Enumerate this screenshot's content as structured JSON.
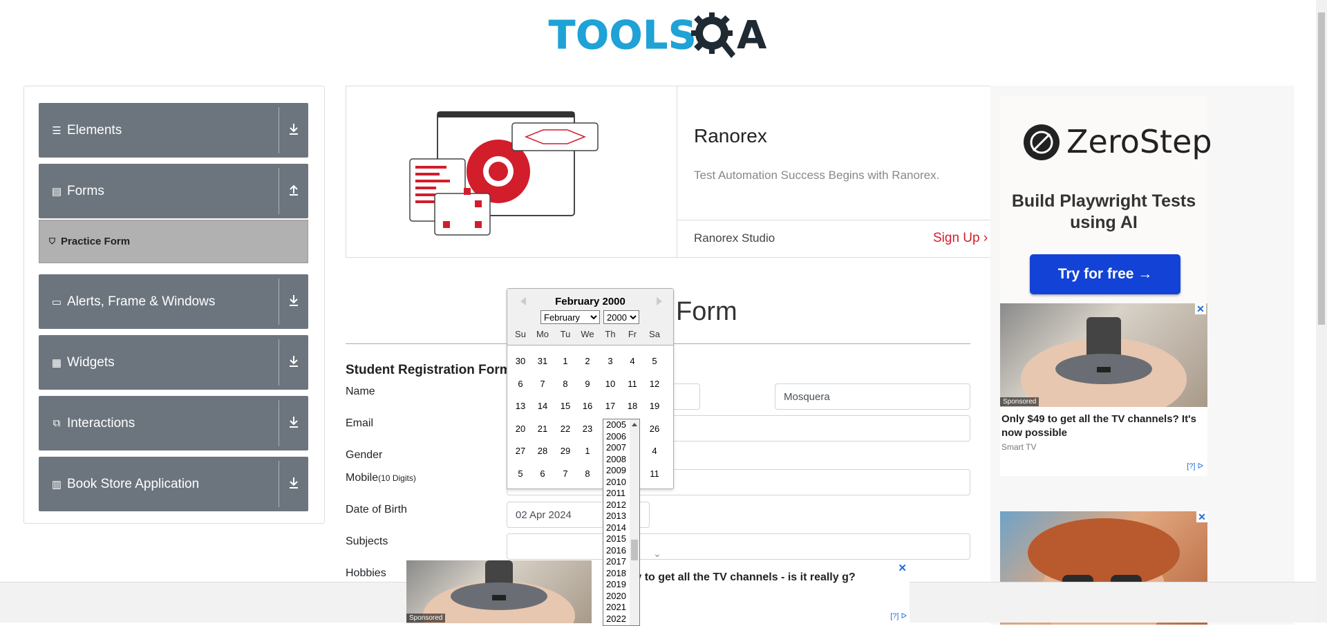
{
  "logo": {
    "text_main": "TOOLS",
    "text_tail": "A"
  },
  "sidebar": {
    "groups": [
      {
        "label": "Elements",
        "icon": "hamburger-icon"
      },
      {
        "label": "Forms",
        "icon": "document-icon"
      },
      {
        "label": "Alerts, Frame & Windows",
        "icon": "window-icon"
      },
      {
        "label": "Widgets",
        "icon": "widgets-icon"
      },
      {
        "label": "Interactions",
        "icon": "interactions-icon"
      },
      {
        "label": "Book Store Application",
        "icon": "books-icon"
      }
    ],
    "active_sub": {
      "label": "Practice Form",
      "icon": "html5-icon"
    }
  },
  "banner": {
    "title": "Ranorex",
    "description": "Test Automation Success Begins with Ranorex.",
    "product": "Ranorex Studio",
    "cta": "Sign Up"
  },
  "page": {
    "title_visible": "Form",
    "section": "Student Registration Form"
  },
  "form": {
    "name_label": "Name",
    "last_name_value": "Mosquera",
    "email_label": "Email",
    "gender_label": "Gender",
    "mobile_label": "Mobile",
    "mobile_hint": "(10 Digits)",
    "dob_label": "Date of Birth",
    "dob_value": "02 Apr 2024",
    "subjects_label": "Subjects",
    "hobbies_label": "Hobbies"
  },
  "calendar": {
    "title": "February 2000",
    "month_select": "February",
    "year_select": "2000",
    "day_names": [
      "Su",
      "Mo",
      "Tu",
      "We",
      "Th",
      "Fr",
      "Sa"
    ],
    "weeks": [
      [
        "30",
        "31",
        "1",
        "2",
        "3",
        "4",
        "5"
      ],
      [
        "6",
        "7",
        "8",
        "9",
        "10",
        "11",
        "12"
      ],
      [
        "13",
        "14",
        "15",
        "16",
        "17",
        "18",
        "19"
      ],
      [
        "20",
        "21",
        "22",
        "23",
        "",
        "",
        "26"
      ],
      [
        "27",
        "28",
        "29",
        "1",
        "",
        "",
        "4"
      ],
      [
        "5",
        "6",
        "7",
        "8",
        "",
        "",
        "11"
      ]
    ],
    "year_options": [
      "2005",
      "2006",
      "2007",
      "2008",
      "2009",
      "2010",
      "2011",
      "2012",
      "2013",
      "2014",
      "2015",
      "2016",
      "2017",
      "2018",
      "2019",
      "2020",
      "2021",
      "2022"
    ]
  },
  "right_ad": {
    "brand": "ZeroStep",
    "headline": "Build Playwright Tests using AI",
    "button": "Try for free →",
    "tv_sponsored": "Sponsored",
    "tv_headline": "Only $49 to get all the TV channels? It's now possible",
    "tv_source": "Smart TV",
    "info": "[?]"
  },
  "bottom_ad": {
    "sponsored": "Sponsored",
    "text": "way to get all the TV channels - is it really g?",
    "info": "[?]"
  },
  "colors": {
    "accent": "#1fa2d6",
    "sidebar": "#6c757d",
    "brand_red": "#d21d2b",
    "cta_blue": "#1343d6"
  }
}
